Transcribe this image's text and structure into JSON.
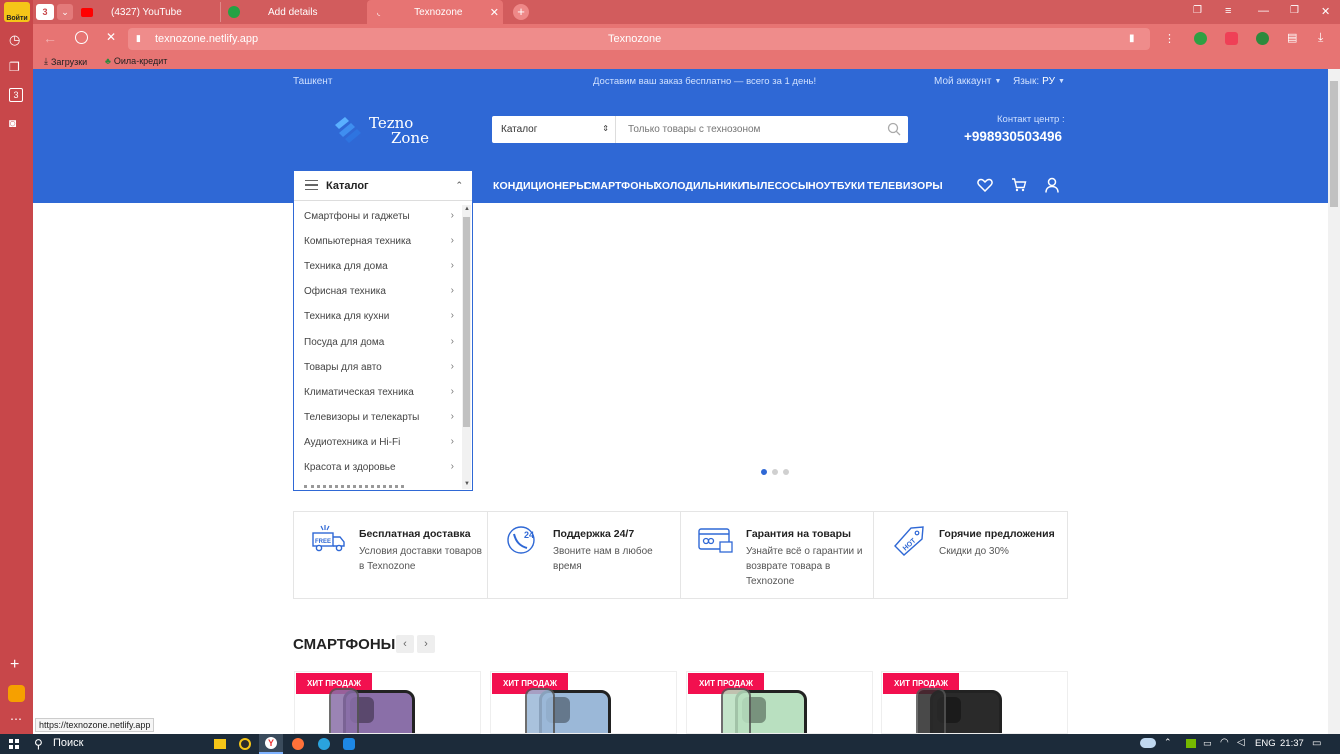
{
  "browser": {
    "login_label": "Войти",
    "tab_counter": "3",
    "sidebar_counter": "3",
    "tabs": [
      {
        "title": "(4327) YouTube"
      },
      {
        "title": "Add details"
      },
      {
        "title": "Texnozone"
      }
    ],
    "url": "texnozone.netlify.app",
    "page_title": "Texnozone",
    "bookmarks": [
      "Загрузки",
      "Оила-кредит"
    ],
    "status_url": "https://texnozone.netlify.app"
  },
  "site": {
    "topbar": {
      "city": "Ташкент",
      "promo": "Доставим ваш заказ бесплатно — всего за 1 день!",
      "account": "Мой аккаунт",
      "language_label": "Язык:",
      "language_value": "РУ"
    },
    "logo": {
      "line1": "Tezno",
      "line2": "Zone"
    },
    "search": {
      "category": "Каталог",
      "placeholder": "Только товары с технозоном"
    },
    "contact": {
      "label": "Контакт центр :",
      "phone": "+998930503496"
    },
    "nav": [
      "КОНДИЦИОНЕРЫ",
      "СМАРТФОНЫ",
      "ХОЛОДИЛЬНИКИ",
      "ПЫЛЕСОСЫ",
      "НОУТБУКИ",
      "ТЕЛЕВИЗОРЫ"
    ],
    "catalog": {
      "title": "Каталог",
      "items": [
        "Смартфоны и гаджеты",
        "Компьютерная техника",
        "Техника для дома",
        "Офисная техника",
        "Техника для кухни",
        "Посуда для дома",
        "Товары для авто",
        "Климатическая техника",
        "Телевизоры и телекарты",
        "Аудиотехника и Hi-Fi",
        "Красота и здоровье"
      ]
    },
    "slider": {
      "active_dot": 1,
      "dot_count": 3
    },
    "features": [
      {
        "title": "Бесплатная доставка",
        "desc": "Условия доставки товаров в Texnozone",
        "icon": "truck-free-icon"
      },
      {
        "title": "Поддержка 24/7",
        "desc": "Звоните нам в любое время",
        "icon": "support-24-icon"
      },
      {
        "title": "Гарантия на товары",
        "desc": "Узнайте всё о гарантии и возврате товара в Texnozone",
        "icon": "warranty-card-icon"
      },
      {
        "title": "Горячие предложения",
        "desc": "Скидки до 30%",
        "icon": "hot-tag-icon"
      }
    ],
    "section": {
      "title": "СМАРТФОНЫ",
      "badge": "ХИТ ПРОДАЖ",
      "phone_colors": [
        "#8a6fa8",
        "#9bb8d8",
        "#b9e0c0",
        "#2a2a2a"
      ]
    }
  },
  "taskbar": {
    "search": "Поиск",
    "lang": "ENG",
    "time": "21:37"
  }
}
